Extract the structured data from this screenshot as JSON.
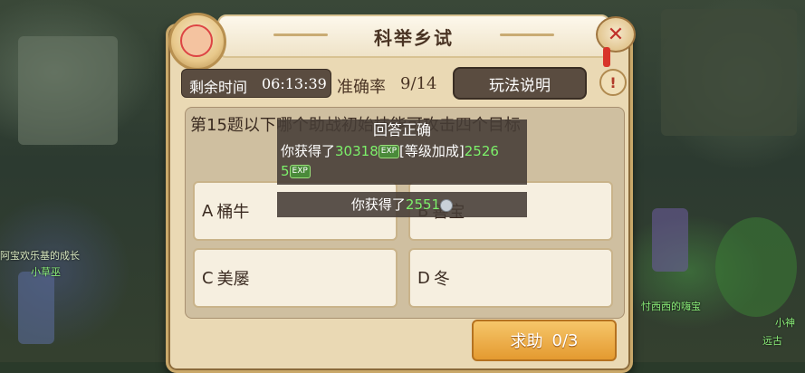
{
  "window": {
    "title": "科举乡试",
    "close_symbol": "✕"
  },
  "stats": {
    "time_label": "剩余时间",
    "time_value": "06:13:39",
    "accuracy_label": "准确率",
    "accuracy_value": "9/14",
    "rules_button": "玩法说明",
    "info_symbol": "!"
  },
  "question": {
    "text": "第15题以下哪个助战初始技能可攻击四个目标"
  },
  "options": [
    {
      "letter": "A",
      "text": "桶牛"
    },
    {
      "letter": "B",
      "text": "善宝"
    },
    {
      "letter": "C",
      "text": "美屡"
    },
    {
      "letter": "D",
      "text": "冬"
    }
  ],
  "help_button": {
    "label": "求助",
    "count": "0/3"
  },
  "toast": {
    "title": "回答正确",
    "prefix": "你获得了",
    "exp_value": "30318",
    "exp_tag": "EXP",
    "bonus_label": "[等级加成]",
    "bonus_value_1": "2526",
    "bonus_value_2": "5",
    "bonus_tag": "EXP"
  },
  "toast2": {
    "prefix": "你获得了",
    "value": "2551"
  },
  "world": {
    "npc_title_left": "阿宝欢乐基的成长",
    "npc_name_left": "小草巫",
    "npc_title_right": "忖西西的嗨宝",
    "npc_name_right": "远古",
    "npc_name_right2": "小神"
  },
  "colors": {
    "panel": "#ead9b4",
    "dark_box": "#5a4c40",
    "help_button": "#e49a30",
    "green_text": "#7cf06a"
  }
}
